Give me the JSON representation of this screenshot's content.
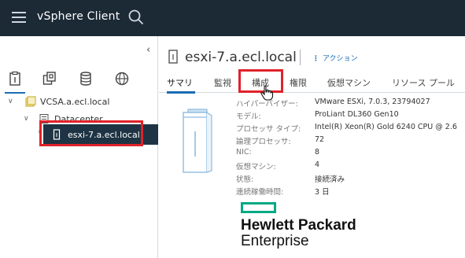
{
  "app": {
    "title": "vSphere Client"
  },
  "navigator": {
    "collapse_label": "‹",
    "tabs": [
      {
        "icon": "hosts-and-clusters-icon"
      },
      {
        "icon": "vms-and-templates-icon"
      },
      {
        "icon": "storage-icon"
      },
      {
        "icon": "networking-icon"
      }
    ],
    "tree": [
      {
        "label": "VCSA.a.ecl.local",
        "caret": "∨",
        "icon": "vcenter-icon"
      },
      {
        "label": "Datacenter",
        "caret": "∨",
        "icon": "datacenter-icon"
      },
      {
        "label": "esxi-7.a.ecl.local",
        "caret": "›",
        "icon": "host-icon",
        "selected": true
      }
    ]
  },
  "object": {
    "title": "esxi-7.a.ecl.local",
    "actions_label": "アクション",
    "tabs": [
      {
        "label": "サマリ"
      },
      {
        "label": "監視"
      },
      {
        "label": "構成"
      },
      {
        "label": "権限"
      },
      {
        "label": "仮想マシン"
      },
      {
        "label": "リソース プール"
      }
    ]
  },
  "summary": {
    "properties": [
      {
        "key": "ハイパーバイザー:",
        "value": "VMware ESXi, 7.0.3, 23794027"
      },
      {
        "key": "モデル:",
        "value": "ProLiant DL360 Gen10"
      },
      {
        "key": "プロセッサ タイプ:",
        "value": "Intel(R) Xeon(R) Gold 6240 CPU @ 2.6"
      },
      {
        "key": "論理プロセッサ:",
        "value": "72"
      },
      {
        "key": "NIC:",
        "value": "8"
      },
      {
        "key": "仮想マシン:",
        "value": "4"
      },
      {
        "key": "状態:",
        "value": "接続済み"
      },
      {
        "key": "連続稼働時間:",
        "value": "3 日"
      }
    ],
    "vendor_logo": {
      "line1": "Hewlett Packard",
      "line2": "Enterprise",
      "color": "#01a982"
    }
  },
  "colors": {
    "topbar": "#1c2a36",
    "accent": "#1b6cb4",
    "highlight": "#e0222a",
    "selected_row": "#1e3444"
  }
}
